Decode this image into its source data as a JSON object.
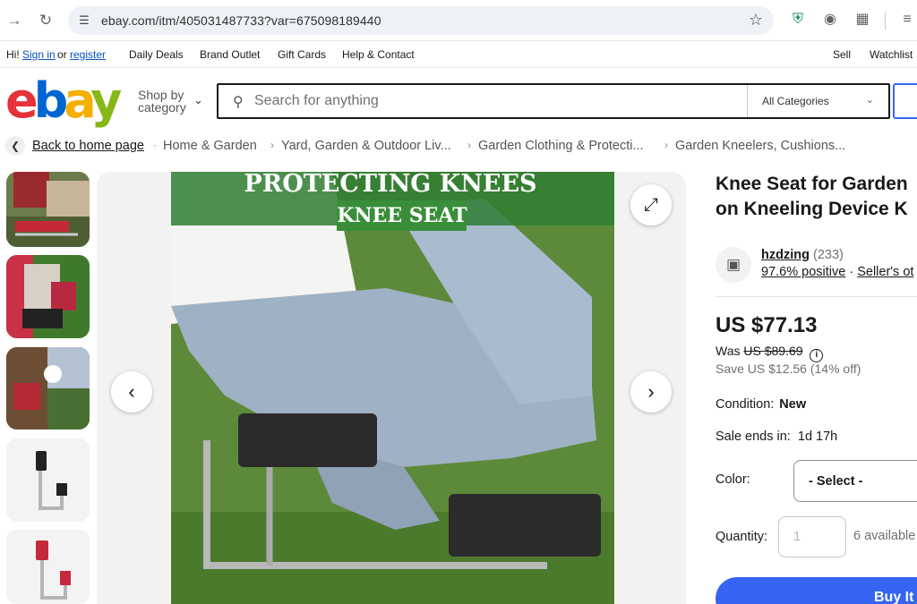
{
  "browser": {
    "url": "ebay.com/itm/405031487733?var=675098189440"
  },
  "topbar": {
    "greeting": "Hi!",
    "sign_in": "Sign in",
    "or": "or",
    "register": "register",
    "daily_deals": "Daily Deals",
    "brand_outlet": "Brand Outlet",
    "gift_cards": "Gift Cards",
    "help_contact": "Help & Contact",
    "sell": "Sell",
    "watchlist": "Watchlist"
  },
  "header": {
    "logo_letters": [
      "e",
      "b",
      "a",
      "y"
    ],
    "shop_by_line1": "Shop by",
    "shop_by_line2": "category",
    "search_placeholder": "Search for anything",
    "category_select": "All Categories"
  },
  "breadcrumb": {
    "items": [
      "Back to home page",
      "Home & Garden",
      "Yard, Garden & Outdoor Liv...",
      "Garden Clothing & Protecti...",
      "Garden Kneelers, Cushions..."
    ]
  },
  "gallery": {
    "banner_line1": "PROTECTING KNEES",
    "banner_line2": "KNEE SEAT"
  },
  "product": {
    "title_line1": "Knee Seat for Garden",
    "title_line2": "on Kneeling Device K",
    "seller_name": "hzdzing",
    "seller_count": "(233)",
    "positive": "97.6% positive",
    "seller_other": "Seller's ot",
    "price": "US $77.13",
    "was_label": "Was",
    "was_price": "US $89.69",
    "info_glyph": "i",
    "save": "Save US $12.56 (14% off)",
    "condition_label": "Condition:",
    "condition_value": "New",
    "sale_ends_label": "Sale ends in:",
    "sale_ends_value": "1d 17h",
    "color_label": "Color:",
    "color_select": "- Select -",
    "quantity_label": "Quantity:",
    "quantity_value": "1",
    "available": "6 available",
    "buy_button": "Buy It"
  }
}
